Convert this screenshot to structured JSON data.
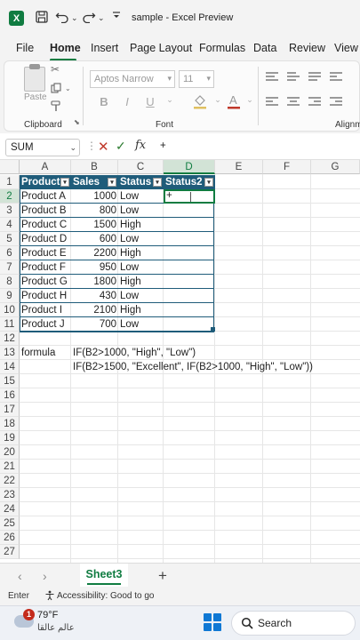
{
  "titlebar": {
    "app_icon_letter": "X",
    "document_title": "sample  -  Excel Preview"
  },
  "menu": {
    "tabs": [
      "File",
      "Home",
      "Insert",
      "Page Layout",
      "Formulas",
      "Data",
      "Review",
      "View"
    ],
    "active": "Home"
  },
  "ribbon": {
    "paste_label": "Paste",
    "clipboard_label": "Clipboard",
    "font_label": "Font",
    "alignment_label": "Alignm",
    "font_name": "Aptos Narrow",
    "font_size": "11",
    "bold": "B",
    "italic": "I",
    "underline": "U",
    "highlight_icon": "paint-bucket-icon",
    "font_color_icon": "font-color-icon"
  },
  "formula_bar": {
    "name_box": "SUM",
    "cancel": "✕",
    "enter": "✓",
    "fx": "fx",
    "value": "+"
  },
  "grid": {
    "columns": [
      "A",
      "B",
      "C",
      "D",
      "E",
      "F",
      "G"
    ],
    "selected_column": "D",
    "rows": [
      "1",
      "2",
      "3",
      "4",
      "5",
      "6",
      "7",
      "8",
      "9",
      "10",
      "11",
      "12",
      "13",
      "14",
      "15",
      "16",
      "17",
      "18",
      "19",
      "20",
      "21",
      "22",
      "23",
      "24",
      "25",
      "26",
      "27"
    ],
    "selected_row": "2",
    "table_headers": [
      "Product",
      "Sales",
      "Status",
      "Status2"
    ],
    "table_rows": [
      {
        "product": "Product A",
        "sales": "1000",
        "status": "Low"
      },
      {
        "product": "Product B",
        "sales": "800",
        "status": "Low"
      },
      {
        "product": "Product C",
        "sales": "1500",
        "status": "High"
      },
      {
        "product": "Product D",
        "sales": "600",
        "status": "Low"
      },
      {
        "product": "Product E",
        "sales": "2200",
        "status": "High"
      },
      {
        "product": "Product F",
        "sales": "950",
        "status": "Low"
      },
      {
        "product": "Product G",
        "sales": "1800",
        "status": "High"
      },
      {
        "product": "Product H",
        "sales": "430",
        "status": "Low"
      },
      {
        "product": "Product I",
        "sales": "2100",
        "status": "High"
      },
      {
        "product": "Product J",
        "sales": "700",
        "status": "Low"
      }
    ],
    "active_cell_value": "+",
    "a13": "formula",
    "b13": "IF(B2>1000, \"High\", \"Low\")",
    "b14": "IF(B2>1500, \"Excellent\", IF(B2>1000, \"High\", \"Low\"))"
  },
  "sheets": {
    "tabs": [
      "Sheet3"
    ],
    "add": "+"
  },
  "status": {
    "mode": "Enter",
    "accessibility": "Accessibility: Good to go"
  },
  "taskbar": {
    "notification_count": "1",
    "temperature": "79°F",
    "weather_text": "عالم عالقا",
    "search_label": "Search"
  }
}
